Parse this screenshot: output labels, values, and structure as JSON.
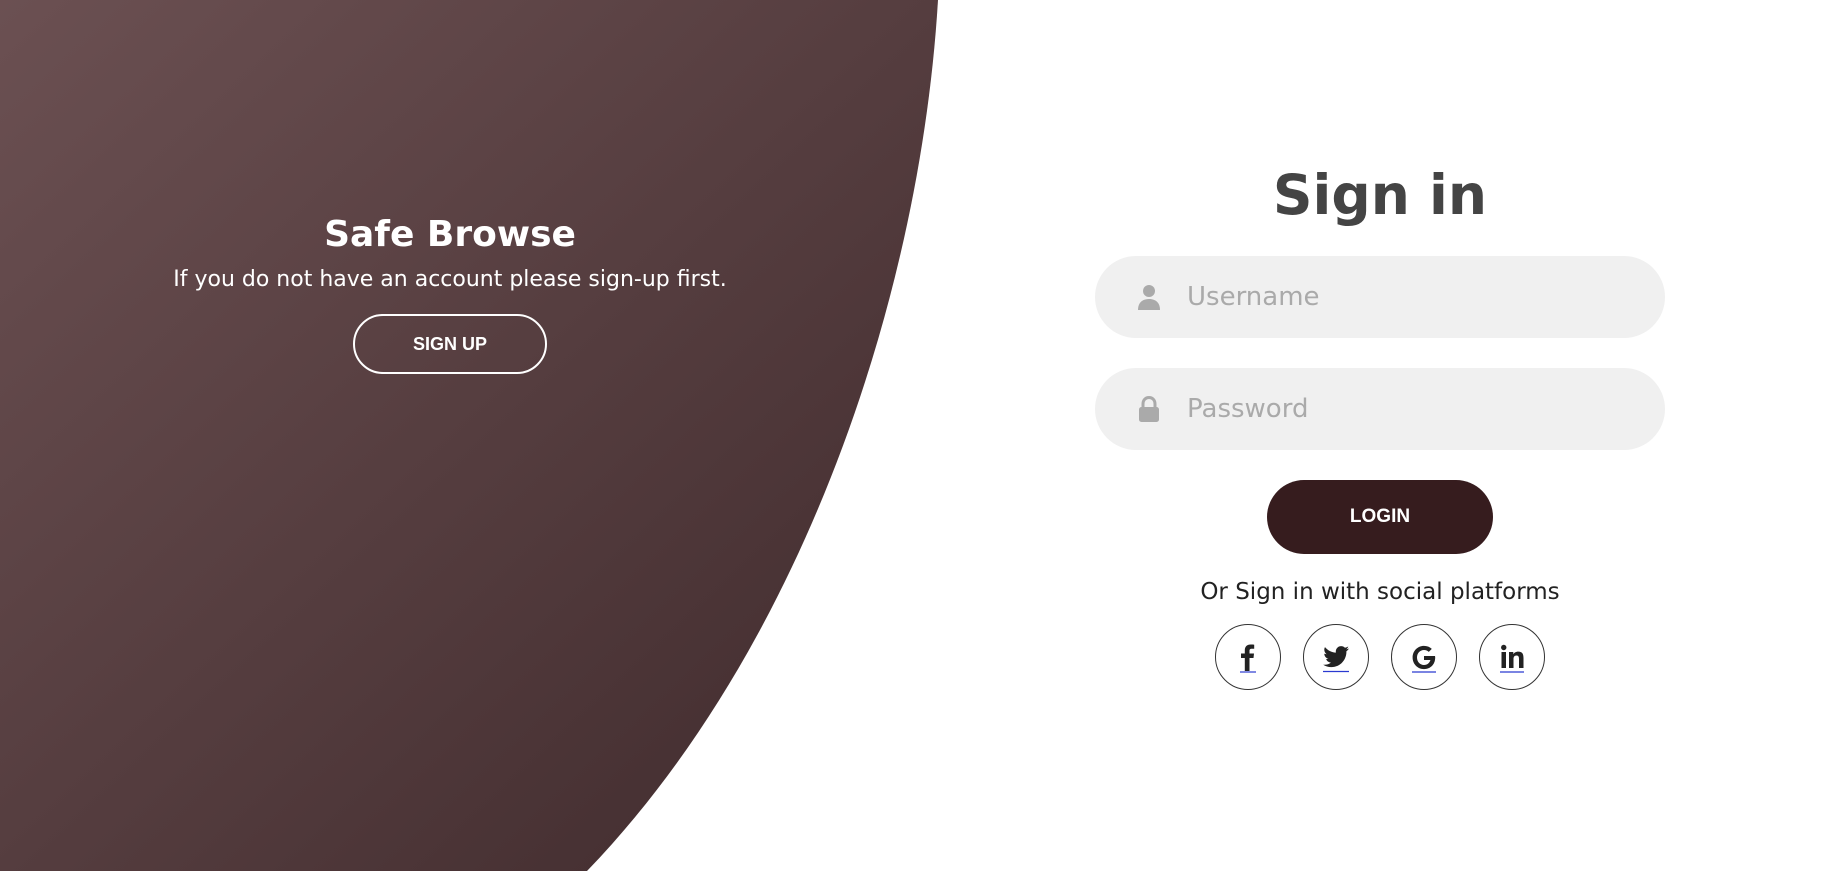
{
  "brand": {
    "panel_gradient_start": "#6b5052",
    "panel_gradient_end": "#3f2a2c",
    "accent": "#361c1e",
    "input_bg": "#f0f0f0"
  },
  "left_panel": {
    "title": "Safe Browse",
    "text": "If you do not have an account please sign-up first.",
    "signup_label": "SIGN UP"
  },
  "signin": {
    "title": "Sign in",
    "username": {
      "placeholder": "Username",
      "value": "",
      "icon": "user-icon"
    },
    "password": {
      "placeholder": "Password",
      "value": "",
      "icon": "lock-icon"
    },
    "login_label": "LOGIN",
    "social_text": "Or Sign in with social platforms",
    "social": [
      {
        "icon": "facebook-icon"
      },
      {
        "icon": "twitter-icon"
      },
      {
        "icon": "google-icon"
      },
      {
        "icon": "linkedin-icon"
      }
    ]
  }
}
